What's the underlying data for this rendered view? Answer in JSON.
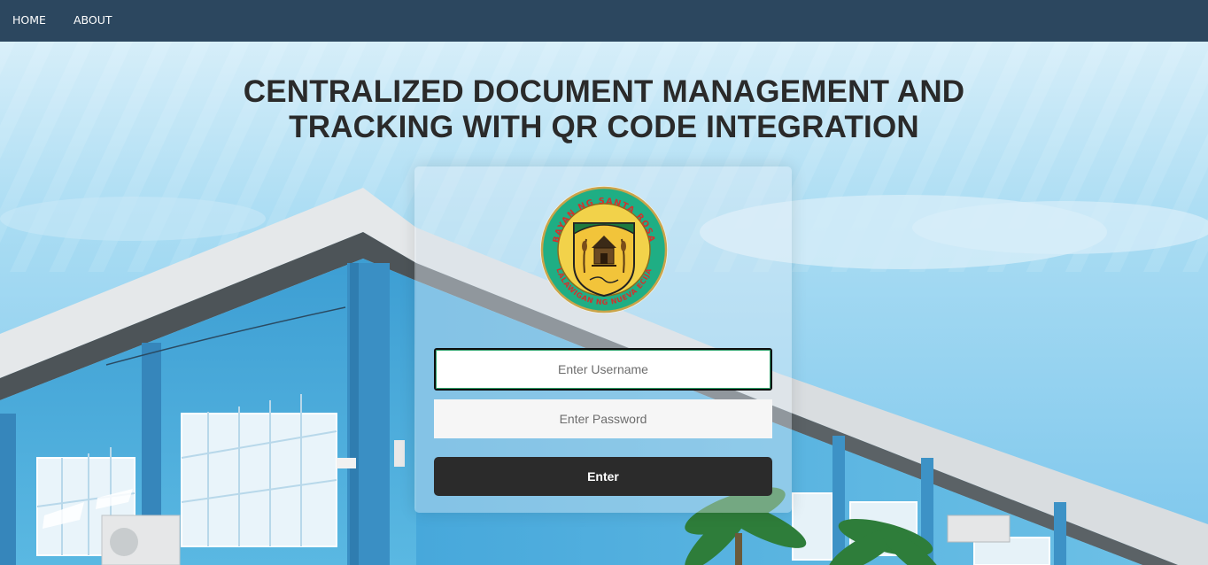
{
  "nav": {
    "home_label": "HOME",
    "about_label": "ABOUT"
  },
  "page": {
    "title_line1": "CENTRALIZED DOCUMENT MANAGEMENT AND",
    "title_line2": "TRACKING WITH QR CODE INTEGRATION"
  },
  "seal": {
    "text_top": "BAYAN NG SANTA ROSA",
    "text_bottom": "LALAWIGAN NG NUEVA ECIJA"
  },
  "login": {
    "username_placeholder": "Enter Username",
    "username_value": "",
    "password_placeholder": "Enter Password",
    "password_value": "",
    "submit_label": "Enter"
  },
  "colors": {
    "navbar": "#2c475f",
    "button": "#2b2b2b",
    "sky": "#8fd0ee",
    "building": "#4da9d9"
  }
}
